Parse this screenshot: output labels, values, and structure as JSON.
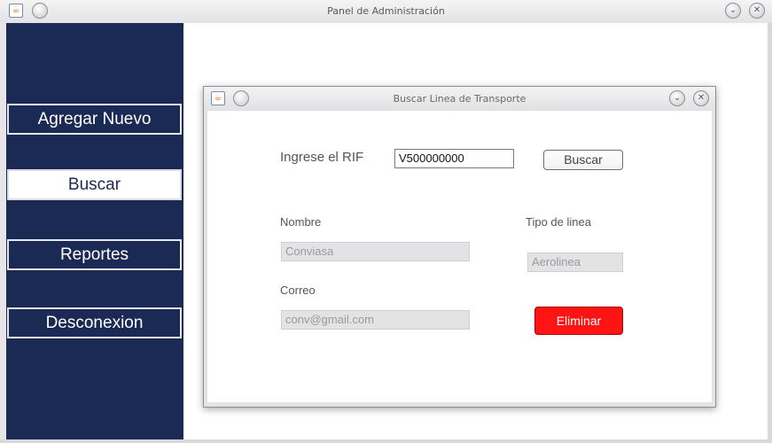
{
  "window": {
    "title": "Panel de Administración",
    "java_icon": "java-coffee-icon",
    "min_icon": "minimize-icon",
    "maximize_icon": "chevron-down-icon",
    "close_icon": "close-icon",
    "menu_glyph": "",
    "maximize_glyph": "⌄",
    "close_glyph": "✕"
  },
  "sidebar": {
    "color": "#1b2a55",
    "items": [
      {
        "label": "Agregar Nuevo",
        "active": false
      },
      {
        "label": "Buscar",
        "active": true
      },
      {
        "label": "Reportes",
        "active": false
      },
      {
        "label": "Desconexion",
        "active": false
      }
    ]
  },
  "dialog": {
    "title": "Buscar Linea de Transporte",
    "rif_label": "Ingrese el RIF",
    "rif_value": "V500000000",
    "search_button": "Buscar",
    "nombre_label": "Nombre",
    "nombre_value": "Conviasa",
    "tipo_label": "Tipo de linea",
    "tipo_value": "Aerolinea",
    "correo_label": "Correo",
    "correo_value": "conv@gmail.com",
    "delete_button": "Eliminar",
    "delete_color": "#ff1414"
  }
}
